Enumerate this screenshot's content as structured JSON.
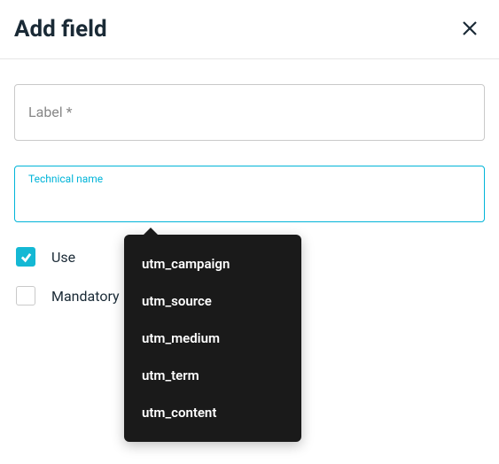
{
  "header": {
    "title": "Add field"
  },
  "fields": {
    "label": {
      "label": "Label *",
      "value": ""
    },
    "technical_name": {
      "label": "Technical name",
      "value": ""
    }
  },
  "checkboxes": {
    "use": {
      "label": "Use",
      "checked": true
    },
    "mandatory": {
      "label": "Mandatory",
      "checked": false
    }
  },
  "dropdown": {
    "items": [
      "utm_campaign",
      "utm_source",
      "utm_medium",
      "utm_term",
      "utm_content"
    ]
  },
  "colors": {
    "accent": "#14b8d4",
    "focus": "#00b4d8",
    "text": "#1a2a36",
    "dropdown_bg": "#1a1a1a"
  }
}
